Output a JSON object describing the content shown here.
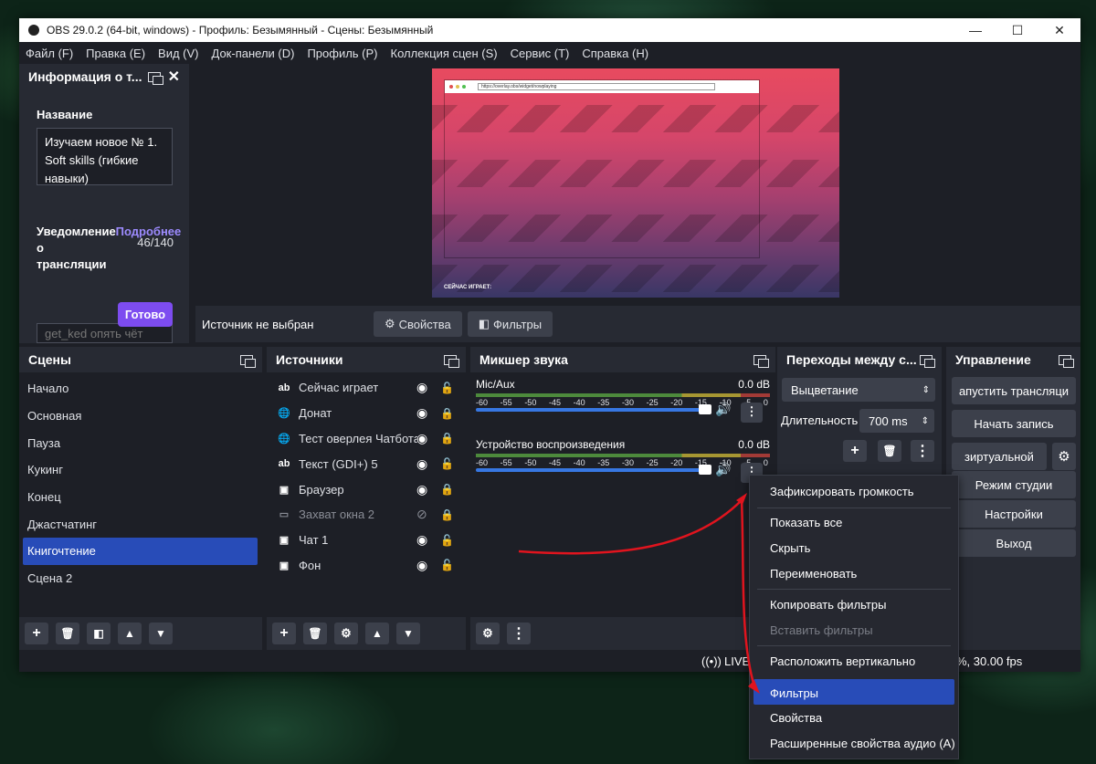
{
  "window": {
    "title": "OBS 29.0.2 (64-bit, windows) - Профиль: Безымянный - Сцены: Безымянный",
    "minimize": "—",
    "maximize": "☐",
    "close": "✕"
  },
  "menu": [
    "Файл (F)",
    "Правка (E)",
    "Вид (V)",
    "Док-панели (D)",
    "Профиль (P)",
    "Коллекция сцен (S)",
    "Сервис (T)",
    "Справка (H)"
  ],
  "info_dock": {
    "title": "Информация о т...",
    "name_label": "Название",
    "name_value": "Изучаем новое № 1. Soft skills (гибкие навыки)",
    "counter": "46/140",
    "notify_label_1": "Уведомление",
    "notify_link": "Подробнее",
    "notify_label_2": "о",
    "notify_label_3": "трансляции",
    "notify_value": "get_ked опять чёт",
    "done": "Готово"
  },
  "preview": {
    "url": "https://overlay.obs/widget/nowplaying",
    "now_playing": "СЕЙЧАС ИГРАЕТ:"
  },
  "source_bar": {
    "status": "Источник не выбран",
    "properties": "Свойства",
    "filters": "Фильтры"
  },
  "scenes": {
    "title": "Сцены",
    "items": [
      "Начало",
      "Основная",
      "Пауза",
      "Кукинг",
      "Конец",
      "Джастчатинг",
      "Книгочтение",
      "Сцена 2"
    ]
  },
  "sources": {
    "title": "Источники",
    "items": [
      {
        "icon": "ab",
        "label": "Сейчас играет"
      },
      {
        "icon": "🌐",
        "label": "Донат"
      },
      {
        "icon": "🌐",
        "label": "Тест оверлея Чатбота"
      },
      {
        "icon": "ab",
        "label": "Текст (GDI+) 5"
      },
      {
        "icon": "▣",
        "label": "Браузер"
      },
      {
        "icon": "▭",
        "label": "Захват окна 2"
      },
      {
        "icon": "▣",
        "label": "Чат 1"
      },
      {
        "icon": "▣",
        "label": "Фон"
      }
    ]
  },
  "mixer": {
    "title": "Микшер звука",
    "channels": [
      {
        "name": "Mic/Aux",
        "level": "0.0 dB"
      },
      {
        "name": "Устройство воспроизведения",
        "level": "0.0 dB"
      }
    ],
    "ticks": [
      "-60",
      "-55",
      "-50",
      "-45",
      "-40",
      "-35",
      "-30",
      "-25",
      "-20",
      "-15",
      "-10",
      "-5",
      "0"
    ]
  },
  "transitions": {
    "title": "Переходы между с...",
    "selected": "Выцветание",
    "duration_label": "Длительность",
    "duration_value": "700 ms"
  },
  "controls": {
    "title": "Управление",
    "start_stream": "апустить трансляци",
    "start_record": "Начать запись",
    "virtual_cam": "зиртуальной",
    "studio_mode": "Режим студии",
    "settings": "Настройки",
    "exit": "Выход"
  },
  "status": {
    "live": "LIVE",
    "fps": "%, 30.00 fps"
  },
  "context_menu": {
    "items": [
      "Зафиксировать громкость",
      "Показать все",
      "Скрыть",
      "Переименовать",
      "Копировать фильтры",
      "Вставить фильтры",
      "Расположить вертикально",
      "Фильтры",
      "Свойства",
      "Расширенные свойства аудио (A)"
    ]
  },
  "colors": {
    "accent": "#284cb8",
    "done_button": "#7d4cf0",
    "arrow": "#e0141e"
  }
}
